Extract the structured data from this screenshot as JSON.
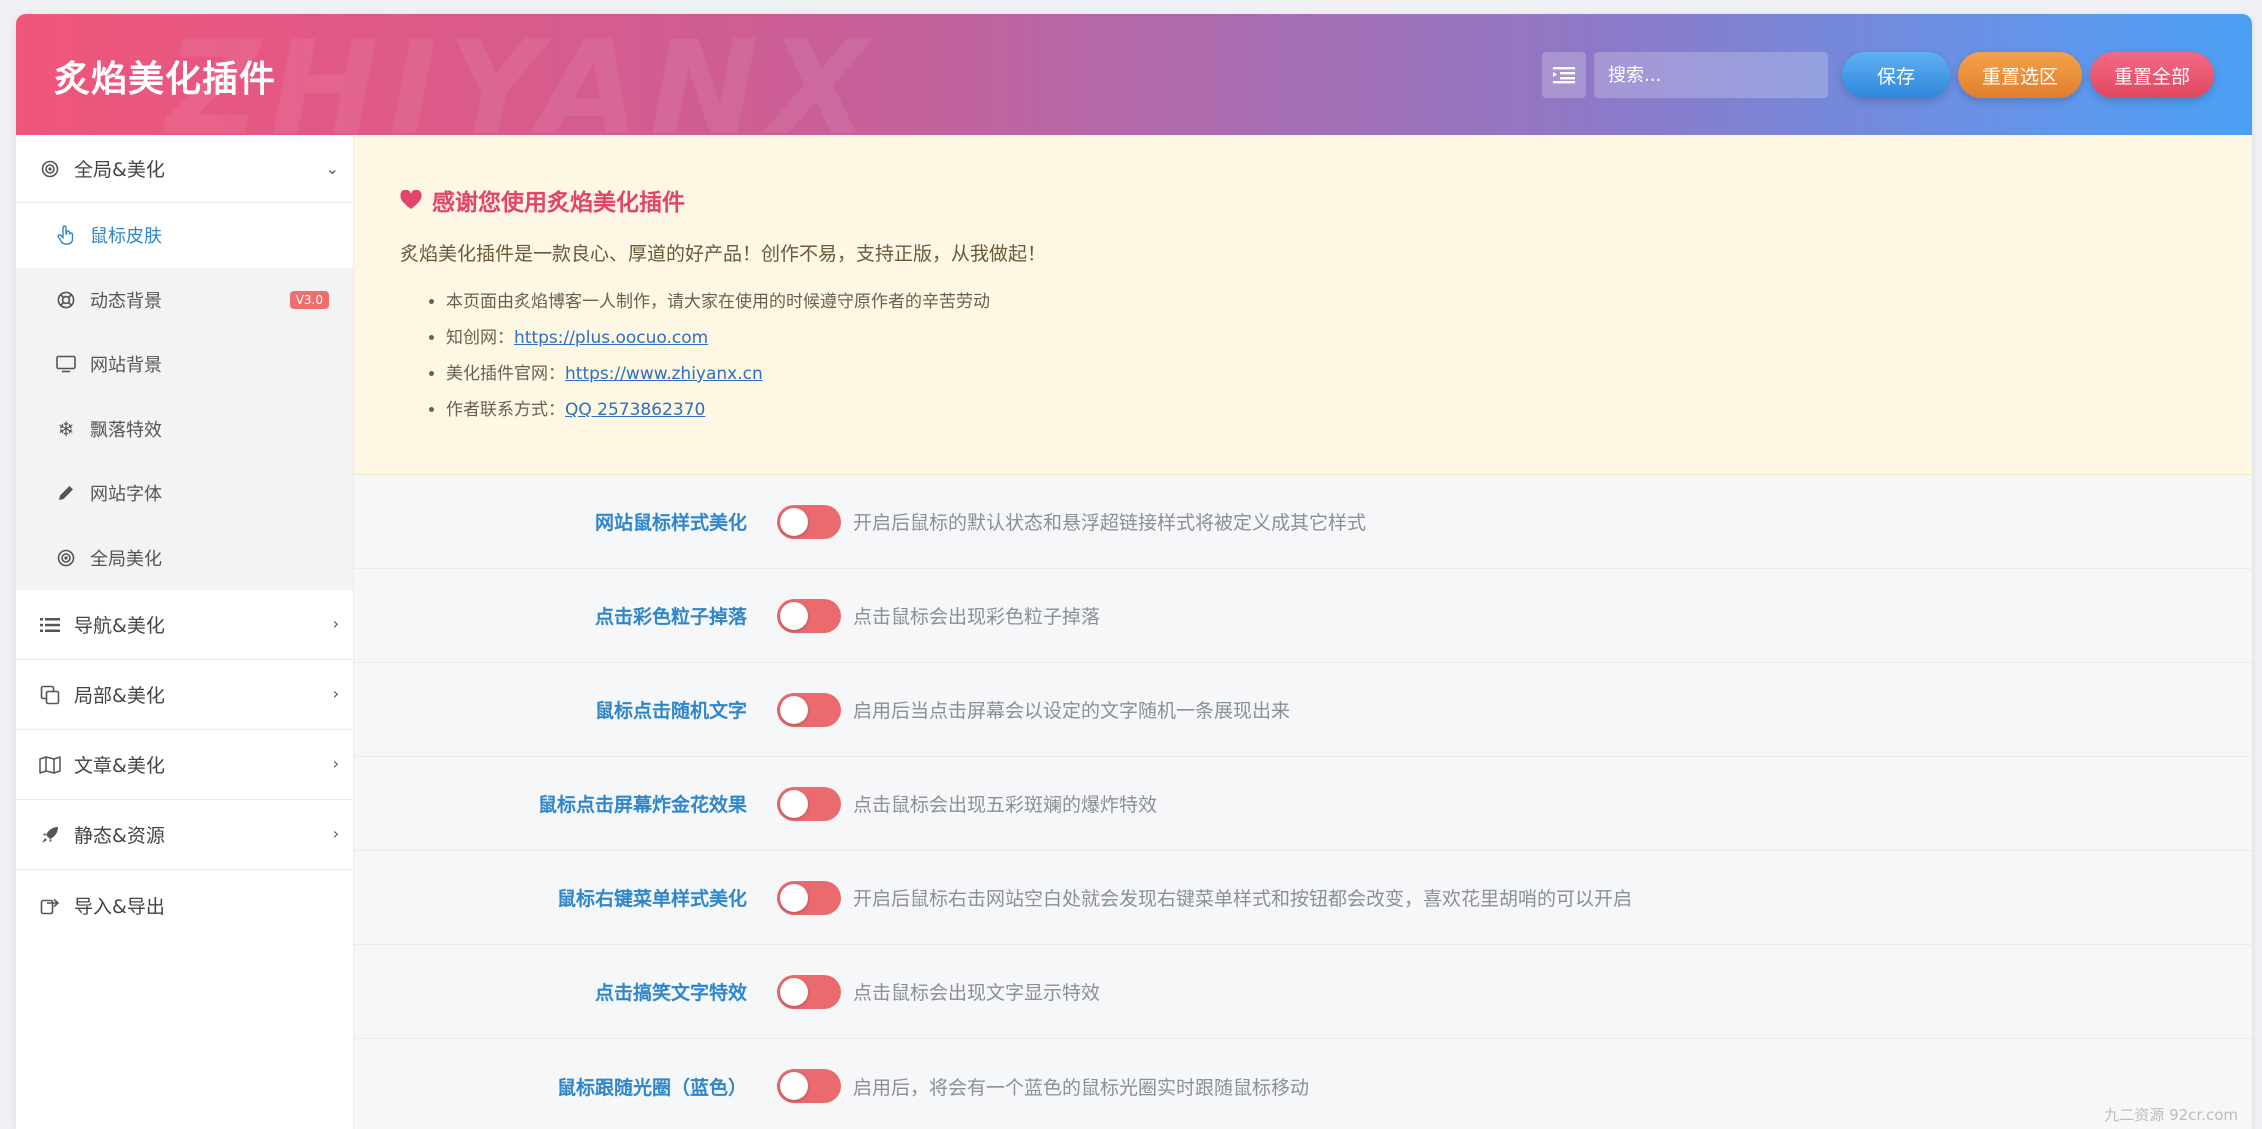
{
  "header": {
    "title": "炙焰美化插件",
    "watermark": "ZHIYANX",
    "search_placeholder": "搜索...",
    "save_label": "保存",
    "reset_selection_label": "重置选区",
    "reset_all_label": "重置全部"
  },
  "sidebar": {
    "groups": [
      {
        "label": "全局&美化",
        "icon": "target-icon",
        "expanded": true,
        "items": [
          {
            "label": "鼠标皮肤",
            "icon": "hand-pointer-icon",
            "active": true
          },
          {
            "label": "动态背景",
            "icon": "life-ring-icon",
            "badge": "V3.0"
          },
          {
            "label": "网站背景",
            "icon": "monitor-icon"
          },
          {
            "label": "飘落特效",
            "icon": "snowflake-icon"
          },
          {
            "label": "网站字体",
            "icon": "pencil-icon"
          },
          {
            "label": "全局美化",
            "icon": "target-icon"
          }
        ]
      },
      {
        "label": "导航&美化",
        "icon": "list-icon"
      },
      {
        "label": "局部&美化",
        "icon": "copy-icon"
      },
      {
        "label": "文章&美化",
        "icon": "map-icon"
      },
      {
        "label": "静态&资源",
        "icon": "rocket-icon"
      },
      {
        "label": "导入&导出",
        "icon": "export-icon"
      }
    ]
  },
  "notice": {
    "title": "感谢您使用炙焰美化插件",
    "intro": "炙焰美化插件是一款良心、厚道的好产品！创作不易，支持正版，从我做起！",
    "bullets": [
      {
        "text": "本页面由炙焰博客一人制作，请大家在使用的时候遵守原作者的辛苦劳动",
        "link": ""
      },
      {
        "text": "知创网：",
        "link": "https://plus.oocuo.com"
      },
      {
        "text": "美化插件官网：",
        "link": "https://www.zhiyanx.cn"
      },
      {
        "text": "作者联系方式：",
        "link": "QQ 2573862370"
      }
    ]
  },
  "settings": [
    {
      "label": "网站鼠标样式美化",
      "enabled": false,
      "desc": "开启后鼠标的默认状态和悬浮超链接样式将被定义成其它样式"
    },
    {
      "label": "点击彩色粒子掉落",
      "enabled": false,
      "desc": "点击鼠标会出现彩色粒子掉落"
    },
    {
      "label": "鼠标点击随机文字",
      "enabled": false,
      "desc": "启用后当点击屏幕会以设定的文字随机一条展现出来"
    },
    {
      "label": "鼠标点击屏幕炸金花效果",
      "enabled": false,
      "desc": "点击鼠标会出现五彩斑斓的爆炸特效"
    },
    {
      "label": "鼠标右键菜单样式美化",
      "enabled": false,
      "desc": "开启后鼠标右击网站空白处就会发现右键菜单样式和按钮都会改变，喜欢花里胡哨的可以开启"
    },
    {
      "label": "点击搞笑文字特效",
      "enabled": false,
      "desc": "点击鼠标会出现文字显示特效"
    },
    {
      "label": "鼠标跟随光圈（蓝色）",
      "enabled": false,
      "desc": "启用后，将会有一个蓝色的鼠标光圈实时跟随鼠标移动"
    }
  ],
  "corner_mark": "九二资源 92cr.com",
  "colors": {
    "accent": "#2f86c9",
    "toggle_off": "#ea6a6e",
    "notice_bg": "#fdf7e3",
    "notice_title": "#e2456b"
  }
}
